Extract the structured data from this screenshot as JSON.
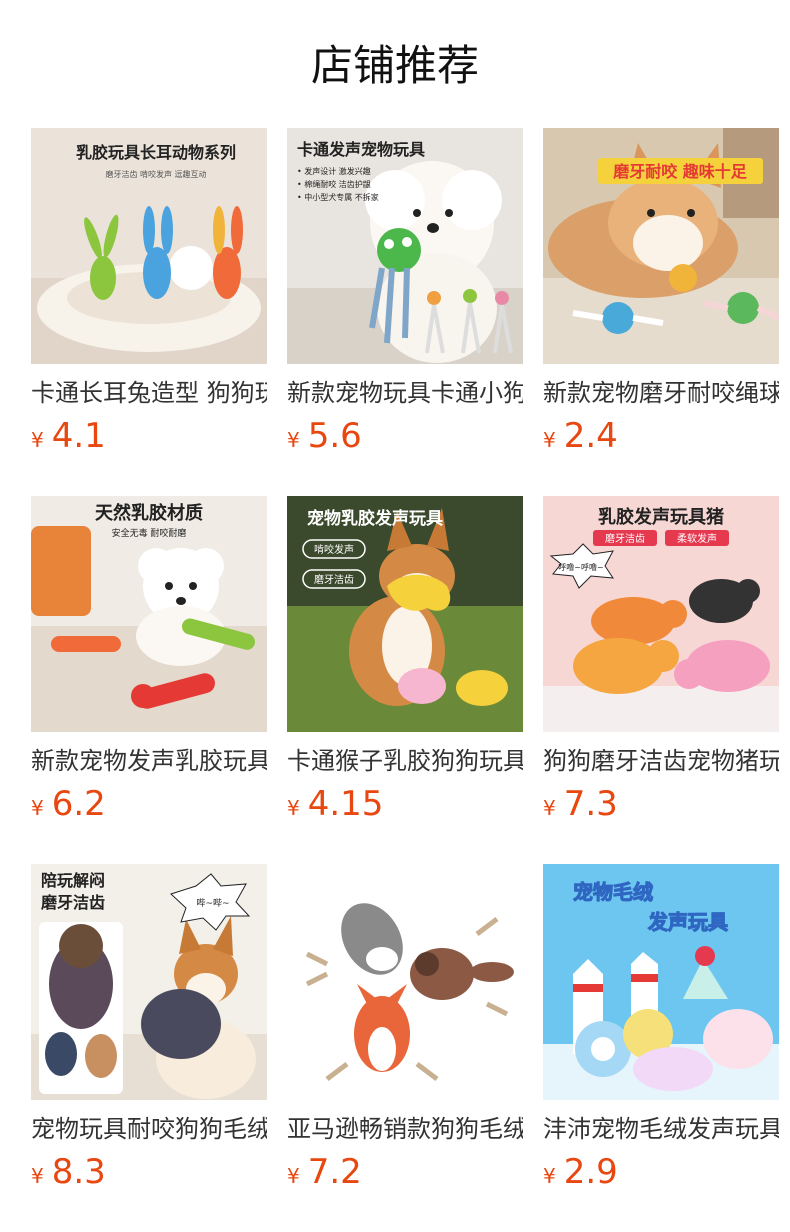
{
  "page": {
    "title": "店铺推荐"
  },
  "products": [
    {
      "name": "卡通长耳兔造型 狗狗玩具",
      "currency": "¥",
      "price": "4.1",
      "image_banner": "乳胶玩具长耳动物系列",
      "image_sub": "磨牙洁齿 啃咬发声 逗趣互动"
    },
    {
      "name": "新款宠物玩具卡通小狗",
      "currency": "¥",
      "price": "5.6",
      "image_banner": "卡通发声宠物玩具",
      "image_sub": "• 发声设计 激发兴趣",
      "image_sub2": "• 棉绳耐咬 洁齿护龈",
      "image_sub3": "• 中小型犬专属 不拆家"
    },
    {
      "name": "新款宠物磨牙耐咬绳球",
      "currency": "¥",
      "price": "2.4",
      "image_banner": "磨牙耐咬 趣味十足"
    },
    {
      "name": "新款宠物发声乳胶玩具",
      "currency": "¥",
      "price": "6.2",
      "image_banner": "天然乳胶材质",
      "image_sub": "安全无毒 耐咬耐磨"
    },
    {
      "name": "卡通猴子乳胶狗狗玩具",
      "currency": "¥",
      "price": "4.15",
      "image_banner": "宠物乳胶发声玩具",
      "image_tag1": "啃咬发声",
      "image_tag2": "磨牙洁齿"
    },
    {
      "name": "狗狗磨牙洁齿宠物猪玩具",
      "currency": "¥",
      "price": "7.3",
      "image_banner": "乳胶发声玩具猪",
      "image_tag1": "磨牙洁齿",
      "image_tag2": "柔软发声",
      "image_bubble": "呼噜~呼噜~"
    },
    {
      "name": "宠物玩具耐咬狗狗毛绒",
      "currency": "¥",
      "price": "8.3",
      "image_banner": "陪玩解闷",
      "image_banner2": "磨牙洁齿",
      "image_bubble": "哔~哔~"
    },
    {
      "name": "亚马逊畅销款狗狗毛绒玩具",
      "currency": "¥",
      "price": "7.2"
    },
    {
      "name": "沣沛宠物毛绒发声玩具",
      "currency": "¥",
      "price": "2.9",
      "image_banner": "宠物毛绒",
      "image_banner2": "发声玩具"
    }
  ],
  "colors": {
    "price": "#e8470f",
    "title": "#111111",
    "name": "#333333"
  }
}
